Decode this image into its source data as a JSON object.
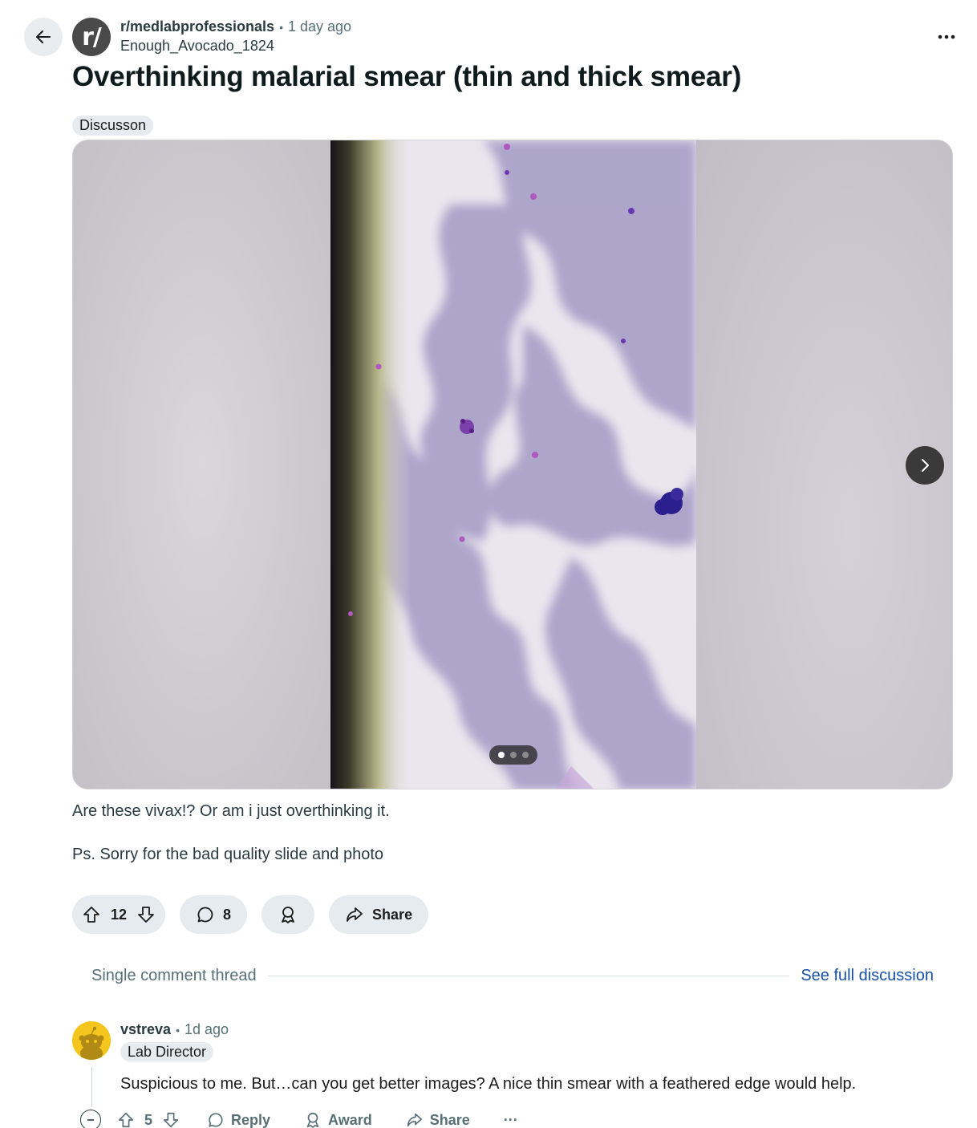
{
  "post": {
    "subreddit": "r/medlabprofessionals",
    "avatar_text": "r/",
    "separator": "•",
    "time": "1 day ago",
    "author": "Enough_Avocado_1824",
    "title": "Overthinking malarial smear (thin and thick smear)",
    "flair": "Discusson",
    "body_line1": "Are these vivax!? Or am i just overthinking it.",
    "body_line2": "Ps. Sorry for the bad quality slide and photo",
    "gallery": {
      "current_index": 1,
      "total": 3
    },
    "actions": {
      "upvotes": "12",
      "comments": "8",
      "share_label": "Share"
    }
  },
  "thread": {
    "label": "Single comment thread",
    "full_link": "See full discussion"
  },
  "comment": {
    "username": "vstreva",
    "separator": "•",
    "time": "1d ago",
    "flair": "Lab Director",
    "text": "Suspicious to me. But…can you get better images? A nice thin smear with a feathered edge would help.",
    "votes": "5",
    "reply_label": "Reply",
    "award_label": "Award",
    "share_label": "Share",
    "more_label": "···"
  },
  "icons": [
    "back-arrow-icon",
    "more-icon",
    "chevron-right-icon",
    "upvote-icon",
    "downvote-icon",
    "comment-icon",
    "award-icon",
    "share-icon",
    "collapse-icon"
  ],
  "colors": {
    "pill_bg": "#e5ebee",
    "link": "#1750a8",
    "meta": "#576f76",
    "avatar_yellow": "#f4c51c"
  }
}
